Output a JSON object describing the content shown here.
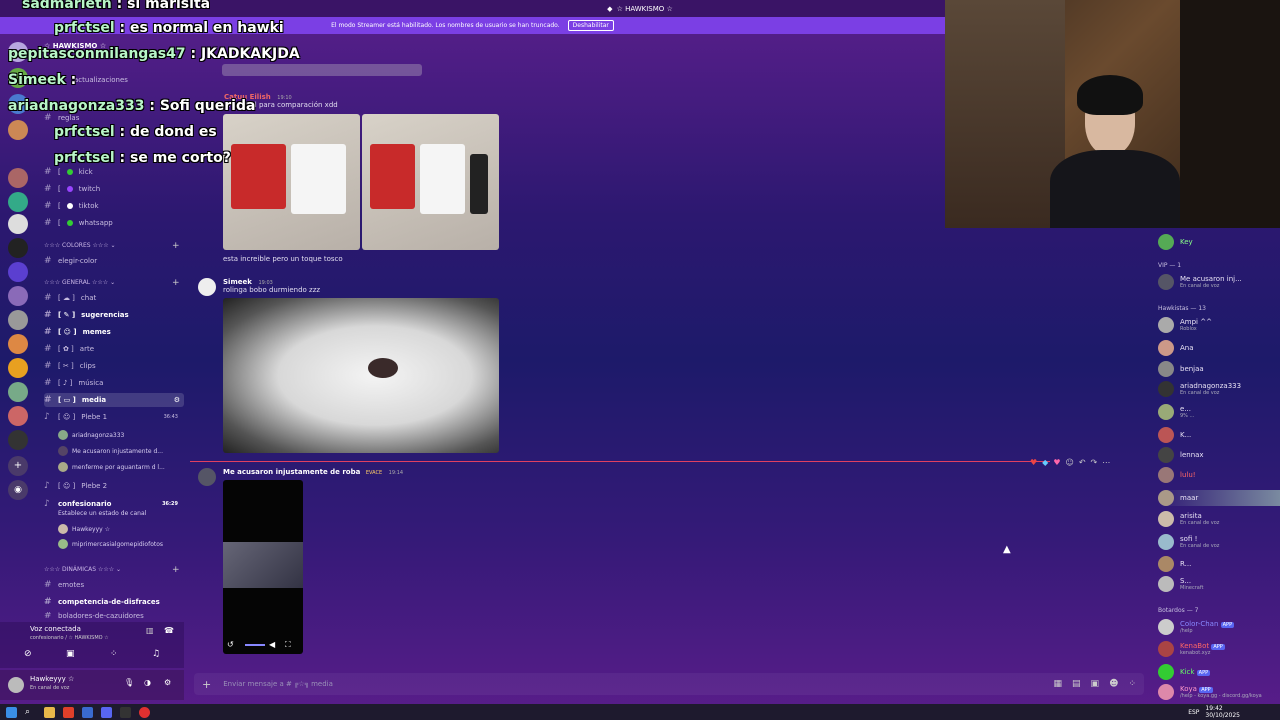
{
  "topbar": {
    "server_title": "☆ HAWKISMO ☆"
  },
  "streamer_bar": {
    "text": "El modo Streamer está habilitado. Los nombres de usuario se han truncado.",
    "button": "Deshabilitar"
  },
  "stream_overlay": [
    {
      "user": "sadmarieth",
      "text": "si marisita"
    },
    {
      "user": "prfctsel",
      "text": "es normal en hawki"
    },
    {
      "user": "pepitasconmilangas47",
      "text": "JKADKAKJDA"
    },
    {
      "user": "Simeek",
      "text": ""
    },
    {
      "user": "ariadnagonza333",
      "text": "Sofi querida"
    },
    {
      "user": "prfctsel",
      "text": "de dond es"
    },
    {
      "user": "prfctsel",
      "text": "se me corto?"
    }
  ],
  "sidebar": {
    "server_name": "☆ HAWKISMO ☆",
    "updates": "actualizaciones",
    "channels_top": [
      {
        "label": "reglas"
      },
      {
        "label": "kick"
      },
      {
        "label": "twitch"
      },
      {
        "label": "tiktok"
      },
      {
        "label": "whatsapp"
      }
    ],
    "cat_colores": "☆☆☆ COLORES ☆☆☆",
    "elegir_color": "elegir-color",
    "cat_general": "☆☆☆ GENERAL ☆☆☆",
    "general_channels": [
      {
        "label": "chat"
      },
      {
        "label": "sugerencias"
      },
      {
        "label": "memes"
      },
      {
        "label": "arte"
      },
      {
        "label": "clips"
      },
      {
        "label": "música"
      },
      {
        "label": "media"
      }
    ],
    "voice_plebe1": {
      "label": "Plebe 1",
      "time": "36:43",
      "users": [
        "ariadnagonza333",
        "Me acusaron injustamente d...",
        "menferme por aguantarm d l..."
      ]
    },
    "voice_plebe2": {
      "label": "Plebe 2"
    },
    "voice_confesionario": {
      "label": "confesionario",
      "time": "36:29",
      "status": "Establece un estado de canal",
      "users": [
        "Hawkeyyy ☆",
        "miprimercasialgomepidiofotos"
      ]
    },
    "cat_dinamicas": "☆☆☆ DINÁMICAS ☆☆☆",
    "emotes": "emotes",
    "competencia": "competencia-de-disfraces",
    "bolsas": "boladores-de-cazuidores"
  },
  "voice_panel": {
    "status": "Voz conectada",
    "channel": "confesionario / ☆ HAWKISMO ☆"
  },
  "user_panel": {
    "name": "Hawkeyyy ☆",
    "status": "En canal de voz"
  },
  "chat": {
    "channel_header": "media",
    "messages": [
      {
        "user": "Catuu Eilish",
        "time": "19:10",
        "text": "el control para comparación xdd",
        "caption": "esta increible pero un toque tosco"
      },
      {
        "user": "Simeek",
        "time": "19:03",
        "text": "rolinga bobo durmiendo zzz"
      },
      {
        "user": "Me acusaron injustamente de roba",
        "badge": "EVACE",
        "time": "19:14"
      }
    ],
    "composer_placeholder": "Enviar mensaje a #  ╔☆╗ media"
  },
  "members": {
    "top_user": "Key",
    "vip_label": "VIP — 1",
    "vip": [
      {
        "name": "Me acusaron inj...",
        "sub": "En canal de voz"
      }
    ],
    "hawkistas_label": "Hawkistas — 13",
    "hawkistas": [
      {
        "name": "Ampi ^^",
        "sub": "Roblox"
      },
      {
        "name": "Ana",
        "sub": ""
      },
      {
        "name": "benjaa",
        "sub": ""
      },
      {
        "name": "ariadnagonza333",
        "sub": "En canal de voz"
      },
      {
        "name": "e...",
        "sub": "9% ..."
      },
      {
        "name": "K...",
        "sub": ""
      },
      {
        "name": "lennax",
        "sub": ""
      },
      {
        "name": "lulu!",
        "sub": ""
      },
      {
        "name": "maar",
        "sub": ""
      },
      {
        "name": "arisita",
        "sub": "En canal de voz"
      },
      {
        "name": "sofi !",
        "sub": "En canal de voz"
      },
      {
        "name": "R...",
        "sub": ""
      },
      {
        "name": "S...",
        "sub": "Minecraft"
      }
    ],
    "bots_label": "Botardos — 7",
    "bots": [
      {
        "name": "Color-Chan",
        "sub": "/help"
      },
      {
        "name": "KenaBot",
        "sub": "kenabot.xyz"
      },
      {
        "name": "Kick",
        "sub": ""
      },
      {
        "name": "Koya",
        "sub": "/help - koya.gg - discord.gg/koya"
      }
    ],
    "app_badge": "APP"
  },
  "taskbar": {
    "time": "19:42",
    "date": "30/10/2025",
    "lang": "ESP"
  }
}
